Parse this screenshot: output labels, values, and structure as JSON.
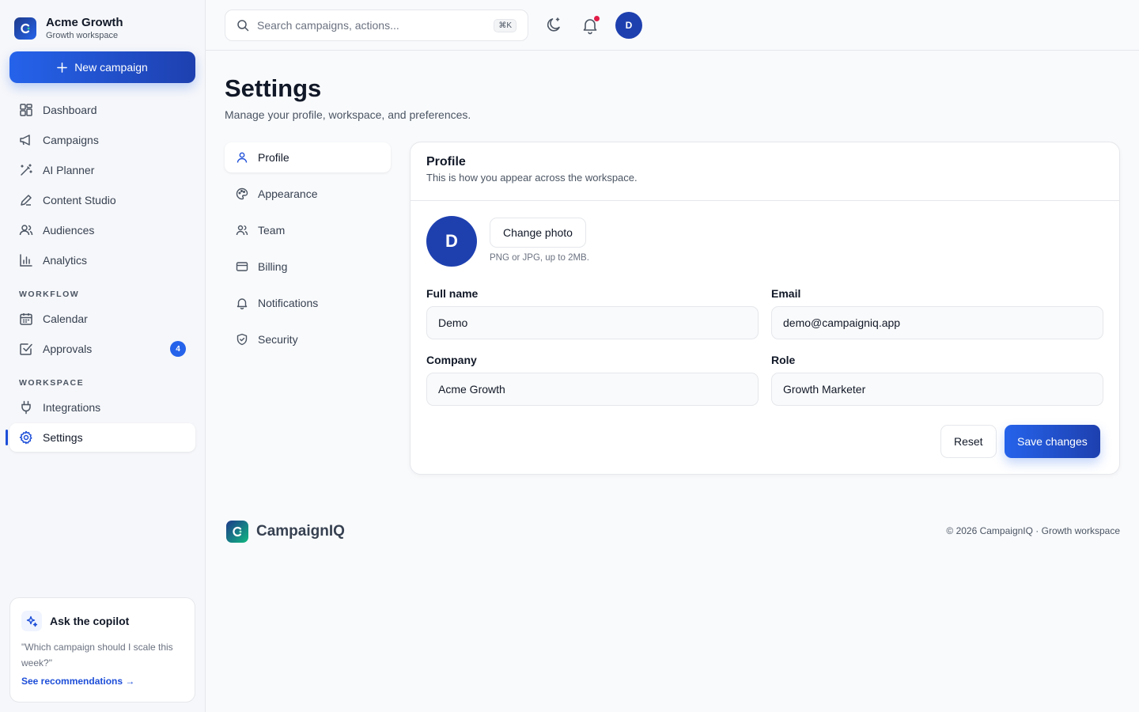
{
  "brand": {
    "name": "Acme Growth",
    "subtitle": "Growth workspace"
  },
  "sidebar": {
    "new_button": "New campaign",
    "items": [
      {
        "label": "Dashboard",
        "icon": "dashboard-icon"
      },
      {
        "label": "Campaigns",
        "icon": "megaphone-icon"
      },
      {
        "label": "AI Planner",
        "icon": "magic-wand-icon"
      },
      {
        "label": "Content Studio",
        "icon": "pen-icon"
      },
      {
        "label": "Audiences",
        "icon": "users-icon"
      },
      {
        "label": "Analytics",
        "icon": "bar-chart-icon"
      }
    ],
    "workflow_label": "WORKFLOW",
    "workflow_items": [
      {
        "label": "Calendar",
        "icon": "calendar-icon"
      },
      {
        "label": "Approvals",
        "icon": "check-square-icon",
        "badge": "4"
      }
    ],
    "workspace_label": "WORKSPACE",
    "workspace_items": [
      {
        "label": "Integrations",
        "icon": "plug-icon"
      },
      {
        "label": "Settings",
        "icon": "gear-icon",
        "active": true
      }
    ],
    "copilot": {
      "title": "Ask the copilot",
      "quote": "\"Which campaign should I scale this week?\"",
      "link": "See recommendations →"
    }
  },
  "topbar": {
    "search_placeholder": "Search campaigns, actions...",
    "shortcut": "⌘K",
    "avatar_initial": "D"
  },
  "page": {
    "title": "Settings",
    "subtitle": "Manage your profile, workspace, and preferences."
  },
  "tabs": [
    {
      "label": "Profile",
      "icon": "user-icon",
      "active": true
    },
    {
      "label": "Appearance",
      "icon": "palette-icon"
    },
    {
      "label": "Team",
      "icon": "team-icon"
    },
    {
      "label": "Billing",
      "icon": "credit-card-icon"
    },
    {
      "label": "Notifications",
      "icon": "bell-icon"
    },
    {
      "label": "Security",
      "icon": "shield-icon"
    }
  ],
  "profile": {
    "title": "Profile",
    "subtitle": "This is how you appear across the workspace.",
    "avatar_initial": "D",
    "change_photo": "Change photo",
    "photo_hint": "PNG or JPG, up to 2MB.",
    "fields": {
      "full_name": {
        "label": "Full name",
        "value": "Demo"
      },
      "email": {
        "label": "Email",
        "value": "demo@campaigniq.app"
      },
      "company": {
        "label": "Company",
        "value": "Acme Growth"
      },
      "role": {
        "label": "Role",
        "value": "Growth Marketer"
      }
    },
    "reset": "Reset",
    "save": "Save changes"
  },
  "footer": {
    "brand": "CampaignIQ",
    "copyright": "© 2026 CampaignIQ · Growth workspace"
  },
  "colors": {
    "accent": "#1d4ed8",
    "badge": "#2563eb",
    "notification_dot": "#e11d48"
  }
}
